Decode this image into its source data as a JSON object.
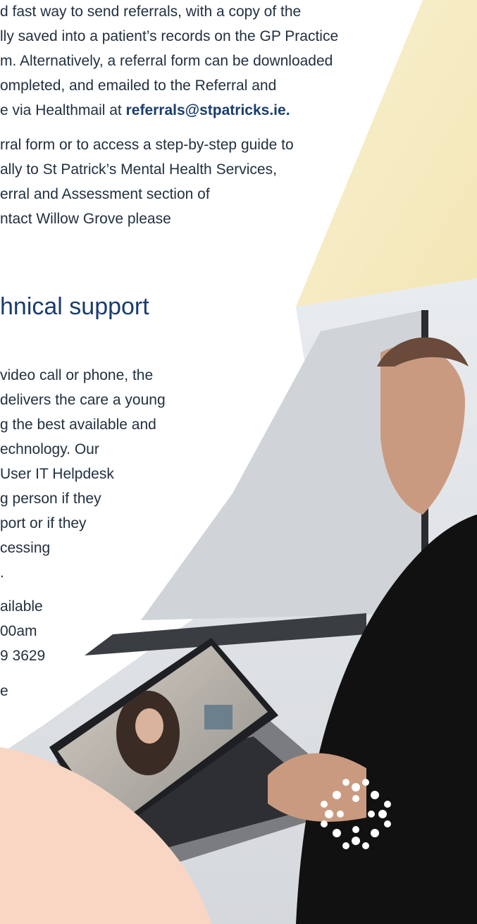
{
  "paragraph1": {
    "lines": [
      "d fast way to send referrals, with a copy of the",
      "lly saved into a patient’s records on the GP Practice",
      "m. Alternatively, a referral form can be downloaded",
      "ompleted, and emailed to the Referral and",
      "e via Healthmail at "
    ],
    "email": "referrals@stpatricks.ie."
  },
  "paragraph2": {
    "lines": [
      "rral form or to access a step-by-step guide to",
      "ally to St Patrick’s Mental Health Services,",
      "erral and Assessment section of",
      "ntact Willow Grove please"
    ]
  },
  "heading": "hnical support",
  "paragraph3": {
    "lines": [
      "video call or phone, the",
      "delivers the care a young",
      "g the best available and",
      "echnology. Our",
      "User IT Helpdesk",
      "g person if they",
      "port or if they",
      "cessing",
      "."
    ]
  },
  "paragraph4": {
    "lines": [
      "ailable",
      "00am",
      "9 3629",
      "e"
    ]
  },
  "colors": {
    "heading": "#1a3c6e",
    "cream": "#f7efc9",
    "peach": "#f9d6c3",
    "shirt": "#111111"
  }
}
